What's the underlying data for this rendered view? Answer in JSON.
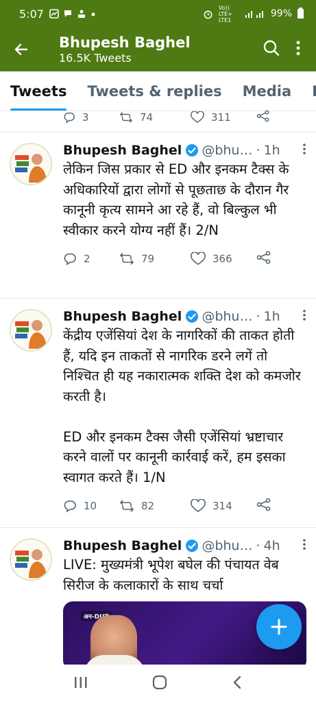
{
  "status_bar": {
    "time": "5:07",
    "network_label": "Vo)) LTE+ LTE1",
    "battery": "99%"
  },
  "header": {
    "name": "Bhupesh Baghel",
    "tweet_count": "16.5K Tweets"
  },
  "tabs": [
    {
      "label": "Tweets",
      "active": true
    },
    {
      "label": "Tweets & replies",
      "active": false
    },
    {
      "label": "Media",
      "active": false
    },
    {
      "label": "Lik",
      "active": false
    }
  ],
  "partial_tweet": {
    "replies": "3",
    "retweets": "74",
    "likes": "311"
  },
  "tweets": [
    {
      "name": "Bhupesh Baghel",
      "handle": "@bhu…",
      "time": "1h",
      "text": "लेकिन जिस प्रकार से ED और इनकम टैक्स के अधिकारियों द्वारा लोगों से पूछताछ के दौरान गैर कानूनी कृत्य सामने आ रहे हैं, वो बिल्कुल भी स्वीकार करने योग्य नहीं हैं। 2/N",
      "replies": "2",
      "retweets": "79",
      "likes": "366"
    },
    {
      "name": "Bhupesh Baghel",
      "handle": "@bhu…",
      "time": "1h",
      "text": "केंद्रीय एजेंसियां देश के नागरिकों की ताकत होती हैं, यदि इन ताकतों से नागरिक डरने लगें तो निश्चित ही यह नकारात्मक शक्ति देश को कमजोर करती है।\n\nED और इनकम टैक्स जैसी एजेंसियां भ्रष्टाचार करने वालों पर कानूनी कार्रवाई करें, हम इसका स्वागत करते हैं। 1/N",
      "replies": "10",
      "retweets": "82",
      "likes": "314"
    },
    {
      "name": "Bhupesh Baghel",
      "handle": "@bhu…",
      "time": "4h",
      "text": "LIVE: मुख्यमंत्री भूपेश बघेल की पंचायत वेब सिरीज के कलाकारों के साथ चर्चा",
      "media_label": "अन-DUT"
    }
  ],
  "colors": {
    "header_bg": "#4d7a12",
    "accent": "#1d9bf0",
    "muted": "#536471"
  },
  "icons": {
    "back": "arrow-left-icon",
    "search": "search-icon",
    "more": "more-vertical-icon",
    "verified": "verified-badge-icon",
    "reply": "reply-icon",
    "retweet": "retweet-icon",
    "like": "heart-icon",
    "share": "share-icon",
    "compose": "plus-icon"
  }
}
